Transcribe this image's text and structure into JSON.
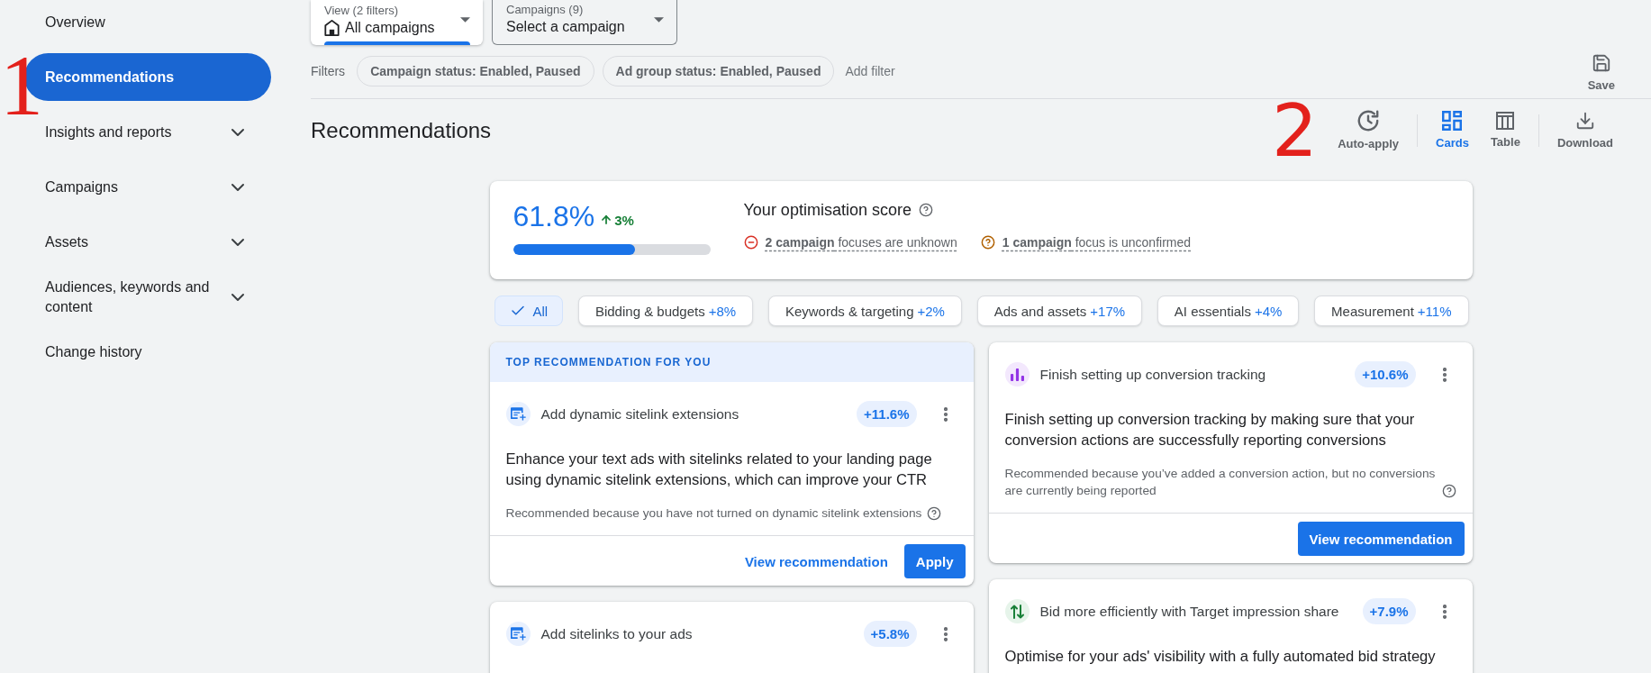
{
  "annotations": [
    {
      "label": "1"
    },
    {
      "label": "2"
    }
  ],
  "sidebar": {
    "items": [
      {
        "label": "Overview",
        "kind": "link",
        "selected": false
      },
      {
        "label": "Recommendations",
        "kind": "link",
        "selected": true
      },
      {
        "label": "Insights and reports",
        "kind": "group",
        "selected": false
      },
      {
        "label": "Campaigns",
        "kind": "group",
        "selected": false
      },
      {
        "label": "Assets",
        "kind": "group",
        "selected": false
      },
      {
        "label": "Audiences, keywords and content",
        "kind": "group",
        "selected": false
      },
      {
        "label": "Change history",
        "kind": "link",
        "selected": false
      }
    ]
  },
  "header": {
    "selects": [
      {
        "kind": "view",
        "label": "View (2 filters)",
        "value": "All campaigns"
      },
      {
        "kind": "campaign",
        "label": "Campaigns (9)",
        "value": "Select a campaign"
      }
    ],
    "filters": {
      "label": "Filters",
      "chips": [
        "Campaign status: Enabled, Paused",
        "Ad group status: Enabled, Paused"
      ],
      "add": "Add filter"
    },
    "save": "Save"
  },
  "page_title": "Recommendations",
  "toolbar": {
    "auto_apply": "Auto-apply",
    "views": [
      {
        "kind": "cards",
        "label": "Cards",
        "selected": true
      },
      {
        "kind": "table",
        "label": "Table",
        "selected": false
      }
    ],
    "download": "Download"
  },
  "score": {
    "value": "61.8%",
    "change": "3%",
    "level": 0.618,
    "title": "Your optimisation score",
    "issues": [
      {
        "kind": "error",
        "text": "**2 campaign** focuses are unknown"
      },
      {
        "kind": "warning",
        "text": "**1 campaign** focus is unconfirmed"
      }
    ]
  },
  "categories": [
    {
      "label": "All",
      "selected": true
    },
    {
      "label": "Bidding & budgets",
      "uplift": "+8%",
      "selected": false
    },
    {
      "label": "Keywords & targeting",
      "uplift": "+2%",
      "selected": false
    },
    {
      "label": "Ads and assets",
      "uplift": "+17%",
      "selected": false
    },
    {
      "label": "AI essentials",
      "uplift": "+4%",
      "selected": false
    },
    {
      "label": "Measurement",
      "uplift": "+11%",
      "selected": false
    }
  ],
  "columns": [
    {
      "cards": [
        {
          "banner": "TOP RECOMMENDATION FOR YOU",
          "kind": "sitelink",
          "title": "Add dynamic sitelink extensions",
          "uplift": "+11.6%",
          "description": "Enhance your text ads with sitelinks related to your landing page using dynamic sitelink extensions, which can improve your CTR",
          "reason": "Recommended because you have not turned on dynamic sitelink extensions",
          "actions": [
            {
              "kind": "link",
              "label": "View recommendation"
            },
            {
              "kind": "primary",
              "label": "Apply"
            }
          ]
        },
        {
          "kind": "sitelink",
          "title": "Add sitelinks to your ads",
          "uplift": "+5.8%"
        }
      ]
    },
    {
      "cards": [
        {
          "kind": "conversion",
          "title": "Finish setting up conversion tracking",
          "uplift": "+10.6%",
          "description": "Finish setting up conversion tracking by making sure that your conversion actions are successfully reporting conversions",
          "reason": "Recommended because you’ve added a conversion action, but no conversions are currently being reported",
          "actions": [
            {
              "kind": "primary",
              "label": "View recommendation"
            }
          ]
        },
        {
          "kind": "bidding",
          "title": "Bid more efficiently with Target impression share",
          "uplift": "+7.9%",
          "description": "Optimise for your ads' visibility with a fully automated bid strategy"
        }
      ]
    }
  ]
}
